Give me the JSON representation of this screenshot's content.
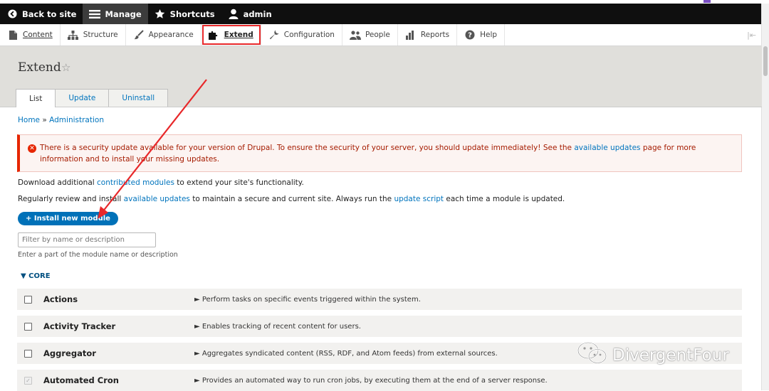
{
  "toolbar": {
    "back": "Back to site",
    "manage": "Manage",
    "shortcuts": "Shortcuts",
    "user": "admin"
  },
  "tray": {
    "items": [
      "Content",
      "Structure",
      "Appearance",
      "Extend",
      "Configuration",
      "People",
      "Reports",
      "Help"
    ]
  },
  "page": {
    "title": "Extend",
    "tabs": [
      "List",
      "Update",
      "Uninstall"
    ],
    "breadcrumb": [
      "Home",
      "Administration"
    ],
    "breadcrumb_sep": "»"
  },
  "alert": {
    "text_before": "There is a security update available for your version of Drupal. To ensure the security of your server, you should update immediately! See the ",
    "link": "available updates",
    "text_after": " page for more information and to install your missing updates."
  },
  "intro": {
    "p1_before": "Download additional ",
    "p1_link": "contributed modules",
    "p1_after": " to extend your site's functionality.",
    "p2_before": "Regularly review and install ",
    "p2_link1": "available updates",
    "p2_mid": " to maintain a secure and current site. Always run the ",
    "p2_link2": "update script",
    "p2_after": " each time a module is updated."
  },
  "install_button": "+ Install new module",
  "filter": {
    "placeholder": "Filter by name or description",
    "description": "Enter a part of the module name or description"
  },
  "core_label": "▼ CORE",
  "modules": [
    {
      "name": "Actions",
      "desc": "► Perform tasks on specific events triggered within the system."
    },
    {
      "name": "Activity Tracker",
      "desc": "► Enables tracking of recent content for users."
    },
    {
      "name": "Aggregator",
      "desc": "► Aggregates syndicated content (RSS, RDF, and Atom feeds) from external sources."
    },
    {
      "name": "Automated Cron",
      "desc": "► Provides an automated way to run cron jobs, by executing them at the end of a server response."
    }
  ],
  "watermark": "DivergentFour",
  "colors": {
    "toolbar_bg": "#0f0f0f",
    "link": "#0074bd",
    "error": "#e62600",
    "highlight": "#e8282a",
    "button": "#0071b8"
  }
}
